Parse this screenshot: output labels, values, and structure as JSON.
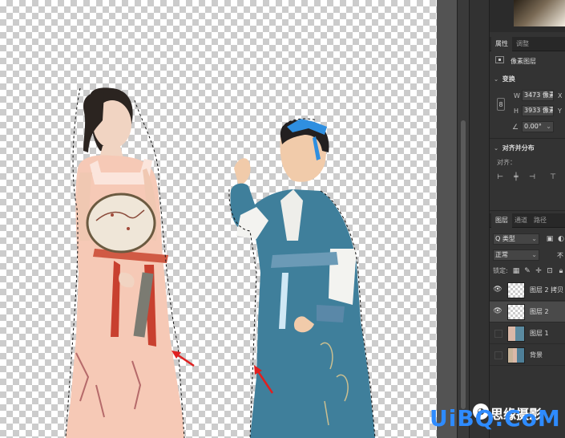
{
  "properties_panel": {
    "tabs": [
      "属性",
      "调整"
    ],
    "layer_type": "像素图层",
    "transform_title": "变换",
    "width_label": "W",
    "width_value": "3473 像素",
    "x_label": "X",
    "height_label": "H",
    "height_value": "3933 像素",
    "y_label": "Y",
    "angle_value": "0.00°",
    "align_title": "对齐并分布",
    "align_label": "对齐："
  },
  "layers_panel": {
    "tabs": [
      "图层",
      "通道",
      "路径"
    ],
    "filter_kind": "Q 类型",
    "blend_mode": "正常",
    "opacity_label": "不",
    "lock_label": "锁定:",
    "layers": [
      {
        "name": "图层 2 拷贝",
        "visible": true,
        "selected": false,
        "thumb": "transparent"
      },
      {
        "name": "图层 2",
        "visible": true,
        "selected": true,
        "thumb": "transparent"
      },
      {
        "name": "图层 1",
        "visible": false,
        "selected": false,
        "thumb": "photo"
      },
      {
        "name": "背景",
        "visible": false,
        "selected": false,
        "thumb": "photo2"
      }
    ]
  },
  "watermark": {
    "brand": "UiBQ.CoM",
    "chinese": "思缘摄影"
  },
  "colors": {
    "arrow": "#e02020",
    "panel_bg": "#333333",
    "canvas_gutter": "#535353"
  }
}
